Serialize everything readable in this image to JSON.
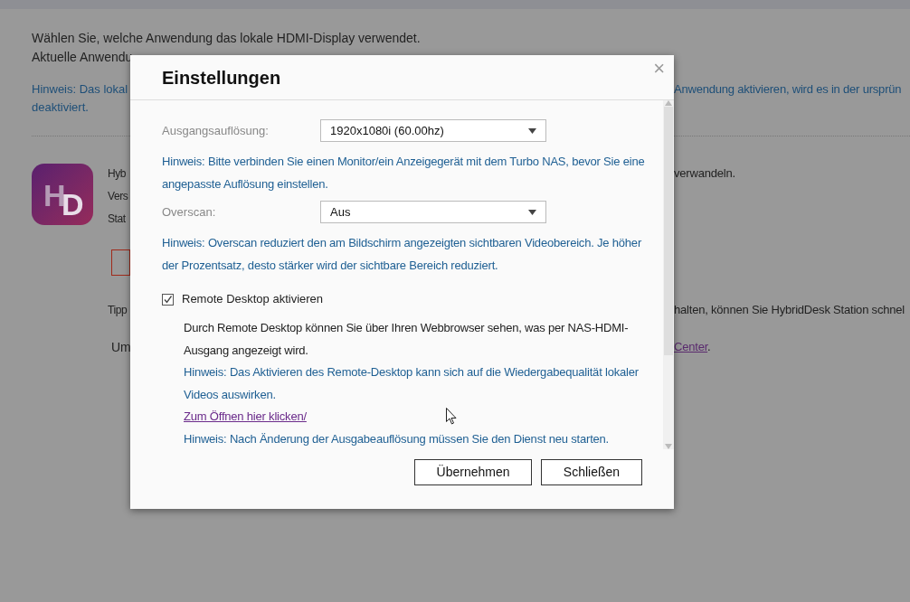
{
  "background": {
    "intro_lines": [
      "Wählen Sie, welche Anwendung das lokale HDMI-Display verwendet.",
      "Aktuelle Anwendu"
    ],
    "hint": {
      "left": "Hinweis: Das lokal",
      "right": "Anwendung aktivieren, wird es in der ursprün",
      "tail": "deaktiviert."
    },
    "app": {
      "logo_letters": [
        "H",
        "D"
      ],
      "info_lines": [
        "Hyb",
        "Vers",
        "Stat"
      ],
      "info_right": "verwandeln."
    },
    "tip": {
      "left": "Tipp",
      "right": "halten, können Sie HybridDesk Station schnel"
    },
    "more": {
      "left": "Um",
      "link": "Center",
      "tail": "."
    }
  },
  "dialog": {
    "title": "Einstellungen",
    "close": "×",
    "fields": [
      {
        "label": "Ausgangsauflösung:",
        "value": "1920x1080i (60.00hz)",
        "hint": "Hinweis: Bitte verbinden Sie einen Monitor/ein Anzeigegerät mit dem Turbo NAS, bevor Sie eine angepasste Auflösung einstellen."
      },
      {
        "label": "Overscan:",
        "value": "Aus",
        "hint": "Hinweis: Overscan reduziert den am Bildschirm angezeigten sichtbaren Videobereich. Je höher der Prozentsatz, desto stärker wird der sichtbare Bereich reduziert."
      }
    ],
    "remote": {
      "label": "Remote Desktop aktivieren",
      "checked": true,
      "description": "Durch Remote Desktop können Sie über Ihren Webbrowser sehen, was per NAS-HDMI-Ausgang angezeigt wird.",
      "hint": "Hinweis: Das Aktivieren des Remote-Desktop kann sich auf die Wiedergabequalität lokaler Videos auswirken.",
      "link": "Zum Öffnen hier klicken/",
      "note": "Hinweis: Nach Änderung der Ausgabeauflösung müssen Sie den Dienst neu starten."
    },
    "buttons": [
      "Übernehmen",
      "Schließen"
    ]
  }
}
